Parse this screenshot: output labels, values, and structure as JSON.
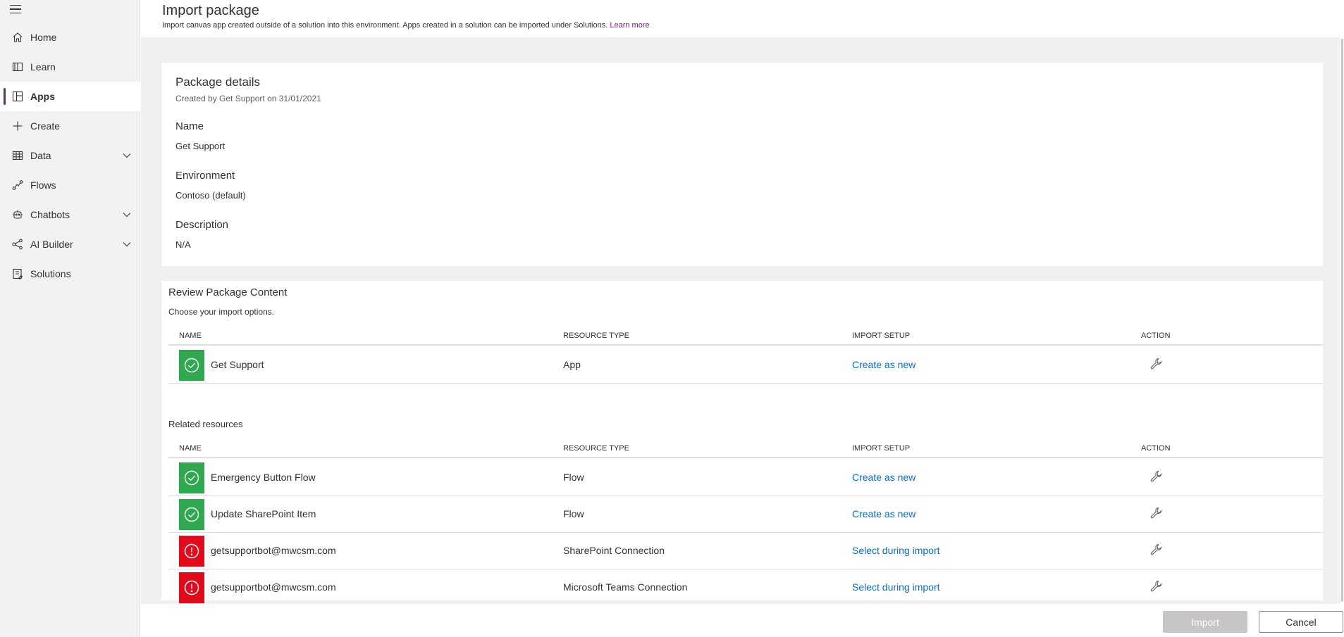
{
  "sidebar": {
    "items": [
      {
        "label": "Home",
        "icon": "home-icon",
        "expandable": false
      },
      {
        "label": "Learn",
        "icon": "book-icon",
        "expandable": false
      },
      {
        "label": "Apps",
        "icon": "apps-icon",
        "expandable": false,
        "active": true
      },
      {
        "label": "Create",
        "icon": "plus-icon",
        "expandable": false
      },
      {
        "label": "Data",
        "icon": "table-icon",
        "expandable": true
      },
      {
        "label": "Flows",
        "icon": "flow-icon",
        "expandable": false
      },
      {
        "label": "Chatbots",
        "icon": "bot-icon",
        "expandable": true
      },
      {
        "label": "AI Builder",
        "icon": "ai-builder-icon",
        "expandable": true
      },
      {
        "label": "Solutions",
        "icon": "solutions-icon",
        "expandable": false
      }
    ]
  },
  "header": {
    "title": "Import package",
    "subtitle": "Import canvas app created outside of a solution into this environment. Apps created in a solution can be imported under Solutions.",
    "learn_more": "Learn more"
  },
  "details": {
    "title": "Package details",
    "subtitle": "Created by Get Support on 31/01/2021",
    "name_label": "Name",
    "name_value": "Get Support",
    "environment_label": "Environment",
    "environment_value": "Contoso (default)",
    "description_label": "Description",
    "description_value": "N/A"
  },
  "review": {
    "title": "Review Package Content",
    "subtitle": "Choose your import options.",
    "columns": {
      "name": "NAME",
      "type": "RESOURCE TYPE",
      "setup": "IMPORT SETUP",
      "action": "ACTION"
    },
    "rows": [
      {
        "name": "Get Support",
        "type": "App",
        "setup": "Create as new",
        "status": "ok"
      }
    ],
    "related_title": "Related resources",
    "related_rows": [
      {
        "name": "Emergency Button Flow",
        "type": "Flow",
        "setup": "Create as new",
        "status": "ok"
      },
      {
        "name": "Update SharePoint Item",
        "type": "Flow",
        "setup": "Create as new",
        "status": "ok"
      },
      {
        "name": "getsupportbot@mwcsm.com",
        "type": "SharePoint Connection",
        "setup": "Select during import",
        "status": "error"
      },
      {
        "name": "getsupportbot@mwcsm.com",
        "type": "Microsoft Teams Connection",
        "setup": "Select during import",
        "status": "error"
      }
    ]
  },
  "footer": {
    "import_label": "Import",
    "cancel_label": "Cancel"
  },
  "colors": {
    "accent": "#742774",
    "link": "#0f6cbd",
    "ok": "#2fa84f",
    "error": "#e00b1c"
  }
}
